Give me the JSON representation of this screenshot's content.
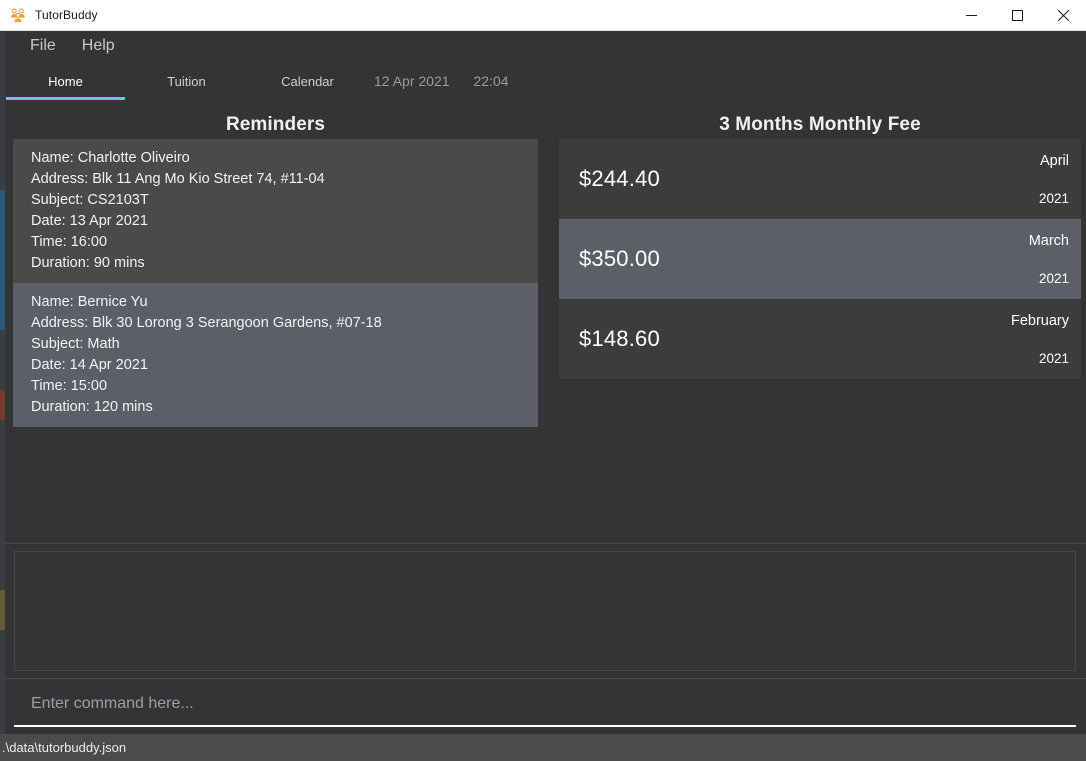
{
  "window": {
    "title": "TutorBuddy",
    "icon": "people-group-icon",
    "controls": {
      "minimize": "minimize-icon",
      "maximize": "maximize-icon",
      "close": "close-icon"
    }
  },
  "menu": {
    "items": [
      {
        "label": "File"
      },
      {
        "label": "Help"
      }
    ]
  },
  "tabs": [
    {
      "label": "Home",
      "active": true
    },
    {
      "label": "Tuition",
      "active": false
    },
    {
      "label": "Calendar",
      "active": false
    }
  ],
  "clock": {
    "date": "12 Apr 2021",
    "time": "22:04"
  },
  "reminders": {
    "title": "Reminders",
    "items": [
      {
        "name": "Name: Charlotte Oliveiro",
        "address": "Address: Blk 11 Ang Mo Kio Street 74, #11-04",
        "subject": "Subject: CS2103T",
        "date": "Date: 13 Apr 2021",
        "time": "Time: 16:00",
        "duration": "Duration: 90 mins"
      },
      {
        "name": "Name: Bernice Yu",
        "address": "Address: Blk 30 Lorong 3 Serangoon Gardens, #07-18",
        "subject": "Subject: Math",
        "date": "Date: 14 Apr 2021",
        "time": "Time: 15:00",
        "duration": "Duration: 120 mins"
      }
    ]
  },
  "monthly_fee": {
    "title": "3 Months Monthly Fee",
    "items": [
      {
        "amount": "$244.40",
        "month": "April",
        "year": "2021"
      },
      {
        "amount": "$350.00",
        "month": "March",
        "year": "2021"
      },
      {
        "amount": "$148.60",
        "month": "February",
        "year": "2021"
      }
    ]
  },
  "result_display": {
    "text": ""
  },
  "command_box": {
    "value": "",
    "placeholder": "Enter command here..."
  },
  "status_bar": {
    "path": ".\\data\\tutorbuddy.json"
  },
  "colors": {
    "accent": "#6cc3e8",
    "window_bg": "#343434",
    "card_odd": "#4a4a4a",
    "card_even": "#5b6066",
    "title_bar": "#ffffff",
    "status_bar": "#4b4b4b",
    "icon_gold": "#e8a33d"
  }
}
